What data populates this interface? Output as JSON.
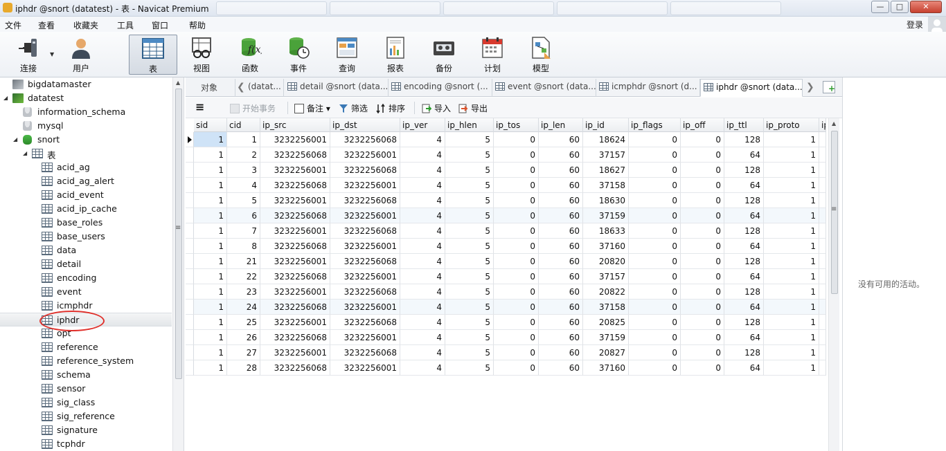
{
  "window": {
    "title": "iphdr @snort (datatest) - 表 - Navicat Premium",
    "buttons": {
      "minimize": "—",
      "maximize": "□",
      "close": "✕"
    }
  },
  "menu": {
    "items": [
      "文件",
      "查看",
      "收藏夹",
      "工具",
      "窗口",
      "帮助"
    ],
    "login": "登录"
  },
  "toolbar": {
    "items": [
      {
        "label": "连接",
        "icon": "plug-icon"
      },
      {
        "label": "用户",
        "icon": "user-icon"
      },
      {
        "label": "表",
        "icon": "table-icon"
      },
      {
        "label": "视图",
        "icon": "view-icon"
      },
      {
        "label": "函数",
        "icon": "function-icon"
      },
      {
        "label": "事件",
        "icon": "event-icon"
      },
      {
        "label": "查询",
        "icon": "query-icon"
      },
      {
        "label": "报表",
        "icon": "report-icon"
      },
      {
        "label": "备份",
        "icon": "backup-icon"
      },
      {
        "label": "计划",
        "icon": "schedule-icon"
      },
      {
        "label": "模型",
        "icon": "model-icon"
      }
    ],
    "active": "表"
  },
  "tree": {
    "connections": [
      {
        "label": "bigdatamaster",
        "icon": "connection-icon"
      },
      {
        "label": "datatest",
        "icon": "connection-icon"
      }
    ],
    "databases": [
      "information_schema",
      "mysql",
      "snort"
    ],
    "group_label": "表",
    "tables": [
      "acid_ag",
      "acid_ag_alert",
      "acid_event",
      "acid_ip_cache",
      "base_roles",
      "base_users",
      "data",
      "detail",
      "encoding",
      "event",
      "icmphdr",
      "iphdr",
      "opt",
      "reference",
      "reference_system",
      "schema",
      "sensor",
      "sig_class",
      "sig_reference",
      "signature",
      "tcphdr"
    ],
    "selected": "iphdr"
  },
  "tabs": {
    "objects_label": "对象",
    "items": [
      {
        "label": "(datat..."
      },
      {
        "label": "detail @snort (data..."
      },
      {
        "label": "encoding @snort (..."
      },
      {
        "label": "event @snort (data..."
      },
      {
        "label": "icmphdr @snort (d..."
      },
      {
        "label": "iphdr @snort (data..."
      }
    ],
    "nav_left": "❮",
    "nav_right": "❯"
  },
  "data_toolbar": {
    "menu_icon": "≡",
    "begin_transaction": "开始事务",
    "note": "备注",
    "filter": "筛选",
    "sort": "排序",
    "import": "导入",
    "export": "导出"
  },
  "grid": {
    "columns": [
      "sid",
      "cid",
      "ip_src",
      "ip_dst",
      "ip_ver",
      "ip_hlen",
      "ip_tos",
      "ip_len",
      "ip_id",
      "ip_flags",
      "ip_off",
      "ip_ttl",
      "ip_proto",
      "ip"
    ],
    "rows": [
      [
        "1",
        "1",
        "3232256001",
        "3232256068",
        "4",
        "5",
        "0",
        "60",
        "18624",
        "0",
        "0",
        "128",
        "1"
      ],
      [
        "1",
        "2",
        "3232256068",
        "3232256001",
        "4",
        "5",
        "0",
        "60",
        "37157",
        "0",
        "0",
        "64",
        "1"
      ],
      [
        "1",
        "3",
        "3232256001",
        "3232256068",
        "4",
        "5",
        "0",
        "60",
        "18627",
        "0",
        "0",
        "128",
        "1"
      ],
      [
        "1",
        "4",
        "3232256068",
        "3232256001",
        "4",
        "5",
        "0",
        "60",
        "37158",
        "0",
        "0",
        "64",
        "1"
      ],
      [
        "1",
        "5",
        "3232256001",
        "3232256068",
        "4",
        "5",
        "0",
        "60",
        "18630",
        "0",
        "0",
        "128",
        "1"
      ],
      [
        "1",
        "6",
        "3232256068",
        "3232256001",
        "4",
        "5",
        "0",
        "60",
        "37159",
        "0",
        "0",
        "64",
        "1"
      ],
      [
        "1",
        "7",
        "3232256001",
        "3232256068",
        "4",
        "5",
        "0",
        "60",
        "18633",
        "0",
        "0",
        "128",
        "1"
      ],
      [
        "1",
        "8",
        "3232256068",
        "3232256001",
        "4",
        "5",
        "0",
        "60",
        "37160",
        "0",
        "0",
        "64",
        "1"
      ],
      [
        "1",
        "21",
        "3232256001",
        "3232256068",
        "4",
        "5",
        "0",
        "60",
        "20820",
        "0",
        "0",
        "128",
        "1"
      ],
      [
        "1",
        "22",
        "3232256068",
        "3232256001",
        "4",
        "5",
        "0",
        "60",
        "37157",
        "0",
        "0",
        "64",
        "1"
      ],
      [
        "1",
        "23",
        "3232256001",
        "3232256068",
        "4",
        "5",
        "0",
        "60",
        "20822",
        "0",
        "0",
        "128",
        "1"
      ],
      [
        "1",
        "24",
        "3232256068",
        "3232256001",
        "4",
        "5",
        "0",
        "60",
        "37158",
        "0",
        "0",
        "64",
        "1"
      ],
      [
        "1",
        "25",
        "3232256001",
        "3232256068",
        "4",
        "5",
        "0",
        "60",
        "20825",
        "0",
        "0",
        "128",
        "1"
      ],
      [
        "1",
        "26",
        "3232256068",
        "3232256001",
        "4",
        "5",
        "0",
        "60",
        "37159",
        "0",
        "0",
        "64",
        "1"
      ],
      [
        "1",
        "27",
        "3232256001",
        "3232256068",
        "4",
        "5",
        "0",
        "60",
        "20827",
        "0",
        "0",
        "128",
        "1"
      ],
      [
        "1",
        "28",
        "3232256068",
        "3232256001",
        "4",
        "5",
        "0",
        "60",
        "37160",
        "0",
        "0",
        "64",
        "1"
      ]
    ],
    "highlighted_rows": [
      5,
      11
    ]
  },
  "info_panel": {
    "message": "没有可用的活动。"
  },
  "colors": {
    "selection_circle": "#e0312c",
    "row_highlight": "#f3f8fc",
    "focus_cell": "#cfe3f7"
  }
}
